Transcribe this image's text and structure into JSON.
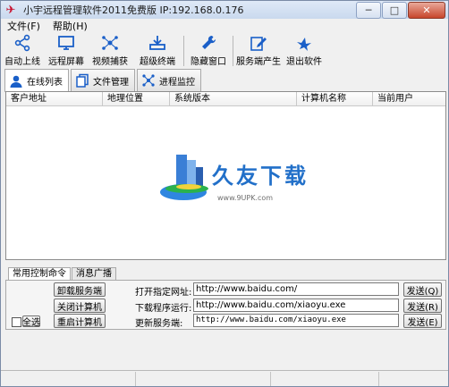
{
  "window": {
    "title": "小宇远程管理软件2011免费版 IP:192.168.0.176",
    "minimize": "─",
    "maximize": "□",
    "close": "✕"
  },
  "menu": [
    "文件(F)",
    "帮助(H)"
  ],
  "toolbar": [
    {
      "label": "自动上线",
      "icon": "share-icon"
    },
    {
      "label": "远程屏幕",
      "icon": "monitor-icon"
    },
    {
      "label": "视频捕获",
      "icon": "network-icon"
    },
    {
      "label": "超级终端",
      "icon": "terminal-icon"
    },
    {
      "label": "隐藏窗口",
      "icon": "wrench-icon"
    },
    {
      "label": "服务端产生",
      "icon": "edit-icon"
    },
    {
      "label": "退出软件",
      "icon": "bird-icon"
    }
  ],
  "tabs": [
    {
      "label": "在线列表",
      "icon": "user-icon"
    },
    {
      "label": "文件管理",
      "icon": "files-icon"
    },
    {
      "label": "进程监控",
      "icon": "process-icon"
    }
  ],
  "columns": [
    "客户地址",
    "地理位置",
    "系统版本",
    "计算机名称",
    "当前用户"
  ],
  "watermark": {
    "text": "久友下载",
    "url": "www.9UPK.com"
  },
  "bottom_tabs": [
    "常用控制命令",
    "消息广播"
  ],
  "commands": {
    "uninstall": "卸载服务端",
    "shutdown": "关闭计算机",
    "restart": "重启计算机",
    "select_all": "全选"
  },
  "rows": [
    {
      "label": "打开指定网址:",
      "value": "http://www.baidu.com/",
      "send": "发送(Q)"
    },
    {
      "label": "下载程序运行:",
      "value": "http://www.baidu.com/xiaoyu.exe",
      "send": "发送(R)"
    },
    {
      "label": "更新服务端:",
      "value": "http://www.baidu.com/xiaoyu.exe",
      "send": "发送(E)"
    }
  ],
  "colors": {
    "accent": "#1a5fc8",
    "title_bg": "#d3e0f2"
  }
}
